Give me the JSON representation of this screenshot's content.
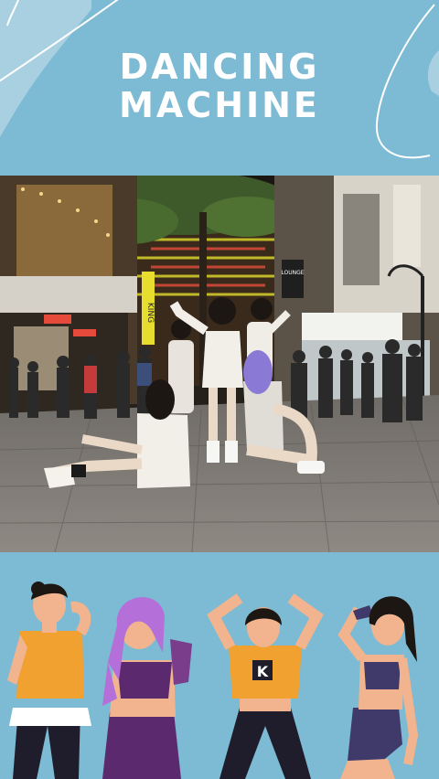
{
  "header": {
    "title_line1": "DANCING",
    "title_line2": "MACHINE"
  },
  "colors": {
    "background": "#7dbad3",
    "title_text": "#ffffff",
    "deco_shape": "#a9d0e0"
  },
  "photo": {
    "signs": [
      "KING",
      "LOUNGE"
    ]
  },
  "illustration": {
    "shirt_logo": "K"
  }
}
